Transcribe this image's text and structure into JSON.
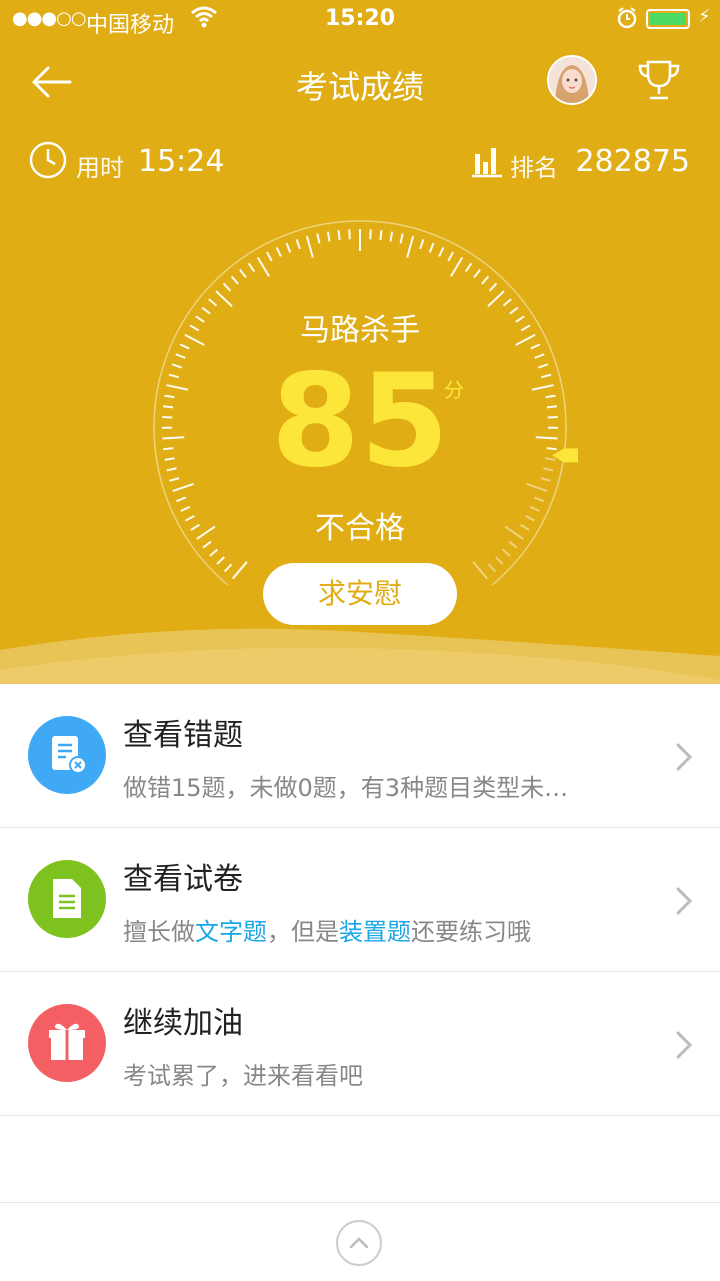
{
  "status_bar": {
    "signal": "●●●○○",
    "carrier": "中国移动",
    "time": "15:20"
  },
  "header": {
    "title": "考试成绩",
    "icons": [
      "back-arrow-icon",
      "avatar",
      "trophy-icon"
    ]
  },
  "stats": {
    "time_label": "用时",
    "time_value": "15:24",
    "rank_label": "排名",
    "rank_value": "282875"
  },
  "result": {
    "rank_title": "马路杀手",
    "score": "85",
    "score_unit": "分",
    "verdict": "不合格",
    "comfort_button": "求安慰",
    "gauge_level": 0.85
  },
  "list": [
    {
      "title": "查看错题",
      "subtitle": "做错15题，未做0题，有3种题目类型未…",
      "icon": "wrong-questions-icon",
      "icon_color": "#3FA9F5"
    },
    {
      "title": "查看试卷",
      "subtitle_parts": [
        "擅长做",
        "文字题",
        "，但是",
        "装置题",
        "还要练习哦"
      ],
      "icon": "document-icon",
      "icon_color": "#7DC21E"
    },
    {
      "title": "继续加油",
      "subtitle": "考试累了，进来看看吧",
      "icon": "gift-icon",
      "icon_color": "#F45F63"
    }
  ],
  "colors": {
    "primary": "#E0AD14",
    "score": "#FCE63A",
    "highlight": "#1BA6E6"
  }
}
